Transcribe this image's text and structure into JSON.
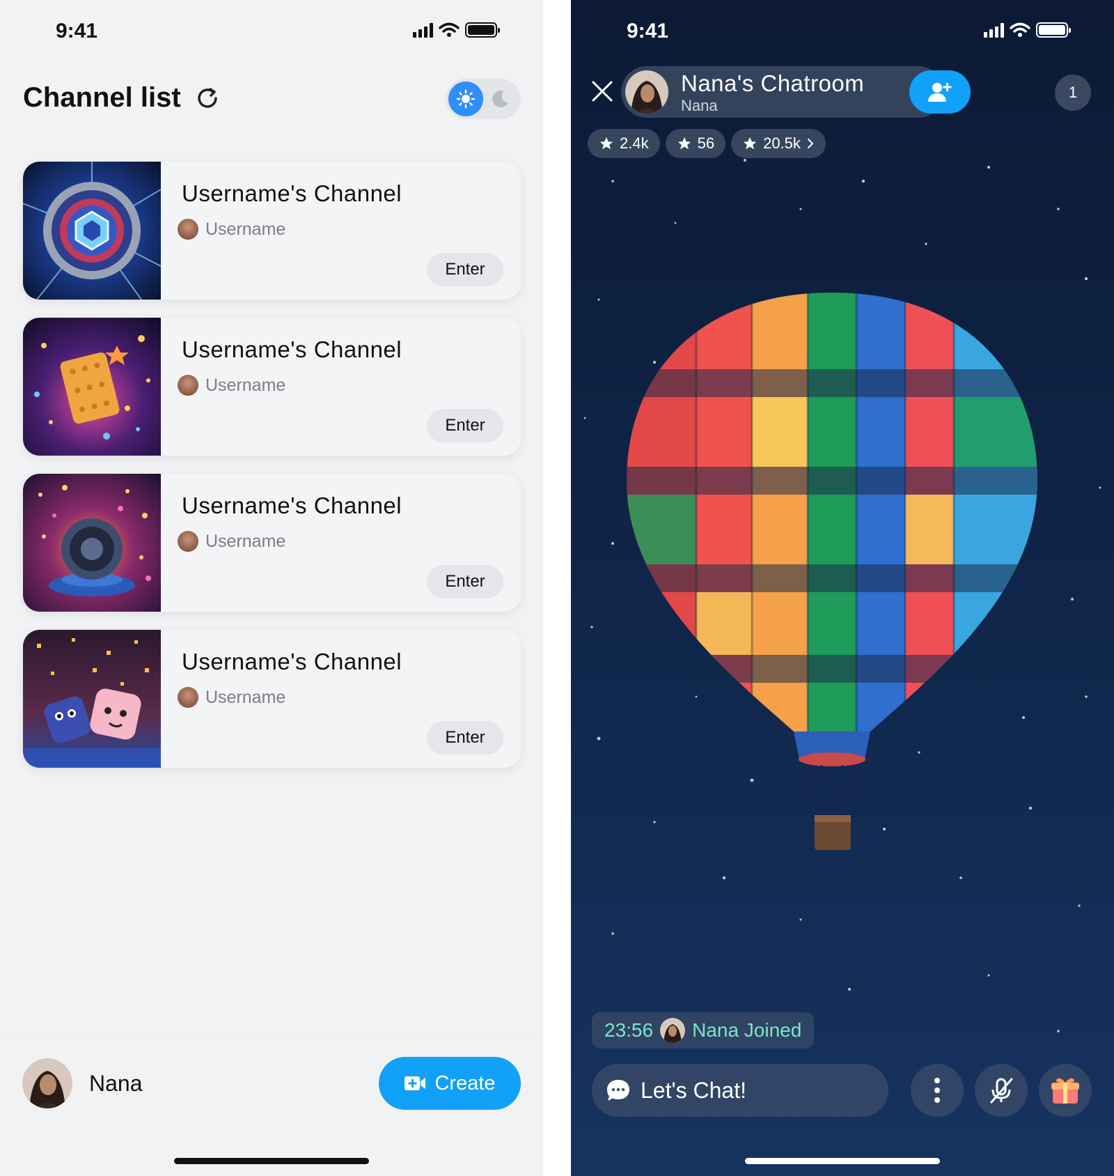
{
  "left": {
    "status": {
      "time": "9:41"
    },
    "header": {
      "title": "Channel list"
    },
    "channels": [
      {
        "title": "Username's Channel",
        "owner": "Username",
        "enter_label": "Enter"
      },
      {
        "title": "Username's Channel",
        "owner": "Username",
        "enter_label": "Enter"
      },
      {
        "title": "Username's Channel",
        "owner": "Username",
        "enter_label": "Enter"
      },
      {
        "title": "Username's Channel",
        "owner": "Username",
        "enter_label": "Enter"
      }
    ],
    "footer": {
      "user_name": "Nana",
      "create_label": "Create"
    }
  },
  "right": {
    "status": {
      "time": "9:41"
    },
    "room": {
      "title": "Nana's Chatroom",
      "host": "Nana",
      "viewer_count": "1"
    },
    "badges": [
      {
        "icon": "star-icon",
        "value": "2.4k"
      },
      {
        "icon": "star-icon",
        "value": "56"
      },
      {
        "icon": "star-icon",
        "value": "20.5k"
      }
    ],
    "message": {
      "time": "23:56",
      "text": "Nana Joined"
    },
    "chat": {
      "placeholder": "Let's Chat!"
    }
  },
  "colors": {
    "accent": "#12a1f8",
    "join_text": "#7ee5c8",
    "bg_light": "#f1f2f4",
    "bg_dark": "#0f2447"
  }
}
